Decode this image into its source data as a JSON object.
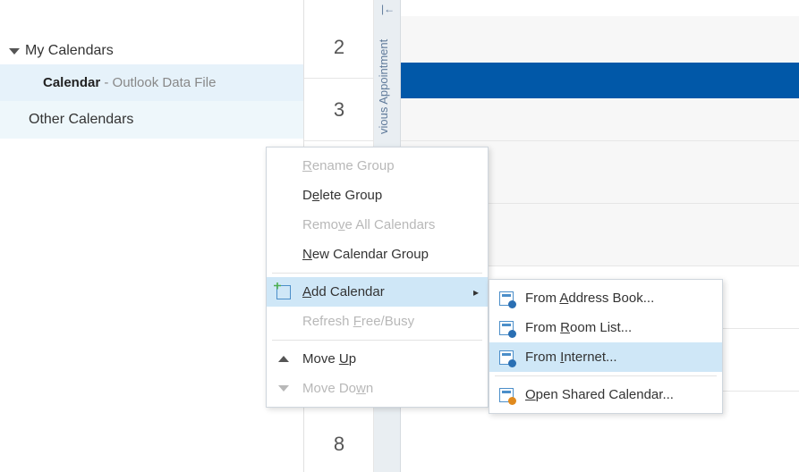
{
  "sidebar": {
    "header": "My Calendars",
    "items": [
      {
        "name": "Calendar",
        "sub": " - Outlook Data File",
        "selected": true
      }
    ],
    "groups": [
      {
        "label": "Other Calendars"
      }
    ]
  },
  "schedule": {
    "prev_label": "vious Appointment",
    "hours": [
      "2",
      "3",
      "",
      "",
      "",
      "",
      "8"
    ],
    "event_row_index": 0
  },
  "context_menu": {
    "items": [
      {
        "key": "rename",
        "label_pre": "",
        "accel": "R",
        "label_post": "ename Group",
        "disabled": true
      },
      {
        "key": "delete",
        "label_pre": "D",
        "accel": "e",
        "label_post": "lete Group",
        "disabled": false
      },
      {
        "key": "removeall",
        "label_pre": "Remo",
        "accel": "v",
        "label_post": "e All Calendars",
        "disabled": true
      },
      {
        "key": "newgroup",
        "label_pre": "",
        "accel": "N",
        "label_post": "ew Calendar Group",
        "disabled": false
      },
      {
        "sep": true
      },
      {
        "key": "addcal",
        "label_pre": "",
        "accel": "A",
        "label_post": "dd Calendar",
        "disabled": false,
        "icon": "cal-add",
        "submenu": true,
        "hover": true
      },
      {
        "key": "refresh",
        "label_pre": "Refresh ",
        "accel": "F",
        "label_post": "ree/Busy",
        "disabled": true
      },
      {
        "sep": true
      },
      {
        "key": "moveup",
        "label_pre": "Move ",
        "accel": "U",
        "label_post": "p",
        "disabled": false,
        "icon": "tri-up"
      },
      {
        "key": "movedown",
        "label_pre": "Move Do",
        "accel": "w",
        "label_post": "n",
        "disabled": true,
        "icon": "tri-down"
      }
    ]
  },
  "submenu": {
    "items": [
      {
        "key": "addrbook",
        "label_pre": "From ",
        "accel": "A",
        "label_post": "ddress Book...",
        "icon": "ab"
      },
      {
        "key": "roomlist",
        "label_pre": "From ",
        "accel": "R",
        "label_post": "oom List...",
        "icon": "rl"
      },
      {
        "key": "internet",
        "label_pre": "From ",
        "accel": "I",
        "label_post": "nternet...",
        "icon": "net",
        "hover": true
      },
      {
        "sep": true
      },
      {
        "key": "shared",
        "label_pre": "",
        "accel": "O",
        "label_post": "pen Shared Calendar...",
        "icon": "sh"
      }
    ]
  }
}
